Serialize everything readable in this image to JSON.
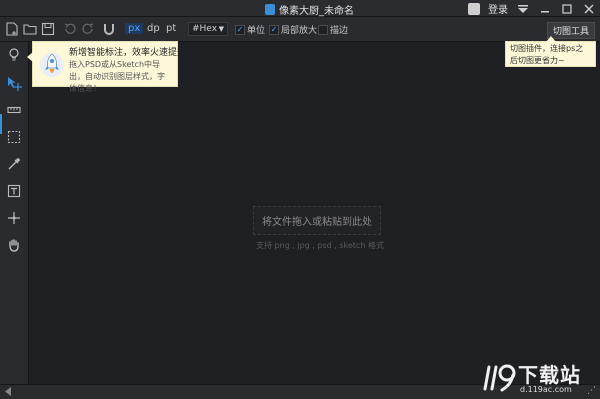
{
  "titlebar": {
    "title": "像素大厨_未命名",
    "login": "登录"
  },
  "toolbar": {
    "units": [
      "px",
      "dp",
      "pt"
    ],
    "active_unit": "px",
    "color_format": "#Hex",
    "checkbox_unit": "单位",
    "checkbox_zoom": "局部放大",
    "checkbox_stroke": "描边",
    "slice_tool_label": "切图工具"
  },
  "tips": {
    "left_title": "新增智能标注，效率火速提升",
    "left_body": "拖入PSD或从Sketch中导出，自动识别图层样式，字体信息！",
    "right_body": "切图插件，连接ps之后切图更省力~"
  },
  "canvas": {
    "drop_label": "将文件拖入或粘贴到此处",
    "drop_hint": "支持 png , jpg , psd , sketch 格式"
  },
  "watermark": {
    "big": "下载站",
    "small": "d.119ac.com"
  },
  "colors": {
    "accent": "#3b8fd9",
    "background": "#1f2023",
    "panel": "#2a2b2f",
    "tooltip": "#fdf8d8"
  }
}
